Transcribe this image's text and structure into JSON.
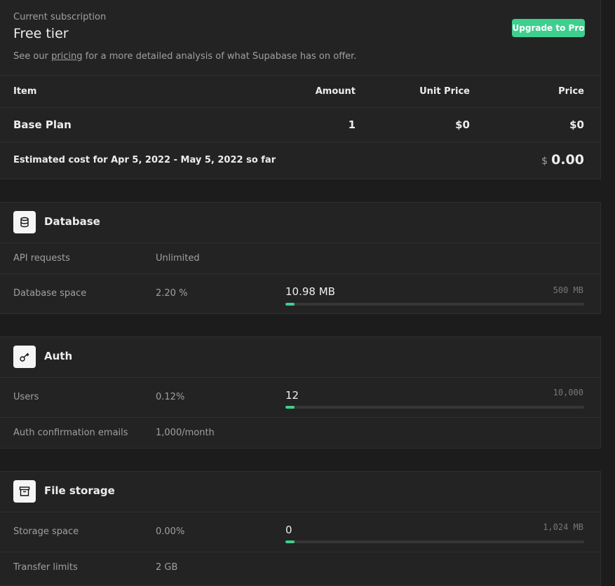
{
  "subscription": {
    "label": "Current subscription",
    "tier": "Free tier",
    "desc_before": "See our ",
    "desc_link": "pricing",
    "desc_after": " for a more detailed analysis of what Supabase has on offer.",
    "upgrade_button": "Upgrade to Pro"
  },
  "table": {
    "headers": {
      "item": "Item",
      "amount": "Amount",
      "unit_price": "Unit Price",
      "price": "Price"
    },
    "rows": [
      {
        "item": "Base Plan",
        "amount": "1",
        "unit_price": "$0",
        "price": "$0"
      }
    ],
    "estimate_label": "Estimated cost for Apr 5, 2022 - May 5, 2022 so far",
    "estimate_currency": "$",
    "estimate_value": "0.00"
  },
  "sections": {
    "database": {
      "title": "Database",
      "icon": "database-icon",
      "rows": {
        "api": {
          "label": "API requests",
          "value": "Unlimited"
        },
        "space": {
          "label": "Database space",
          "percent": "2.20 %",
          "used": "10.98 MB",
          "limit": "500  MB",
          "fill_fraction": 0.022
        }
      }
    },
    "auth": {
      "title": "Auth",
      "icon": "key-icon",
      "rows": {
        "users": {
          "label": "Users",
          "percent": "0.12%",
          "used": "12",
          "limit": "10,000",
          "fill_fraction": 0.0012
        },
        "emails": {
          "label": "Auth confirmation emails",
          "value": "1,000/month"
        }
      }
    },
    "storage": {
      "title": "File storage",
      "icon": "archive-icon",
      "rows": {
        "space": {
          "label": "Storage space",
          "percent": "0.00%",
          "used": "0",
          "limit": "1,024  MB",
          "fill_fraction": 0.0
        },
        "transfer": {
          "label": "Transfer limits",
          "value": "2 GB"
        }
      }
    }
  },
  "colors": {
    "accent": "#3ecf8e",
    "background": "#1c1c1c",
    "panel": "#232323"
  }
}
